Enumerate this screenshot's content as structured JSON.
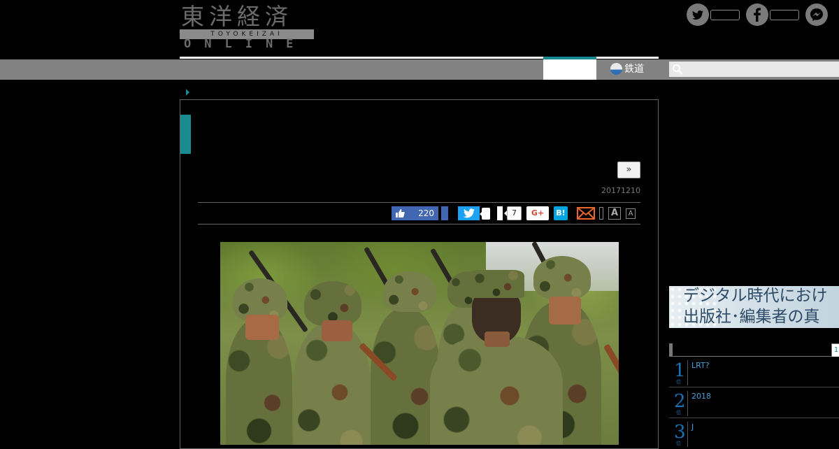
{
  "logo": {
    "kanji": "東洋経済",
    "band": "TOYOKEIZAI",
    "online": "ONLINE"
  },
  "social_top": {
    "items": [
      {
        "icon": "twitter-icon",
        "glyph": "t"
      },
      {
        "icon": "facebook-icon",
        "glyph": "f"
      },
      {
        "icon": "messenger-icon",
        "glyph": "m"
      }
    ]
  },
  "nav": {
    "railway_label": "鉄道",
    "search_placeholder": ""
  },
  "article": {
    "next_label": "»",
    "date": "20171210"
  },
  "share": {
    "like_count": "220",
    "pocket_count": "7",
    "gplus_label": "G+",
    "hatena_label": "B!",
    "font_large": "A",
    "font_small": "A"
  },
  "sidebar": {
    "ad_line1": "デジタル時代におけ",
    "ad_line2": "出版社･編集者の真",
    "ranking_tab": "1",
    "ranking": [
      {
        "rank": "1",
        "suffix": "位",
        "title": "LRT?"
      },
      {
        "rank": "2",
        "suffix": "位",
        "title": "2018"
      },
      {
        "rank": "3",
        "suffix": "位",
        "title": "J"
      }
    ]
  },
  "colors": {
    "accent": "#1a8a92",
    "nav_bar": "#828282",
    "facebook": "#4267b2",
    "twitter": "#1da1f2",
    "hatena": "#00a4de",
    "gplus": "#d34836",
    "rank_blue": "#1a73b6"
  }
}
